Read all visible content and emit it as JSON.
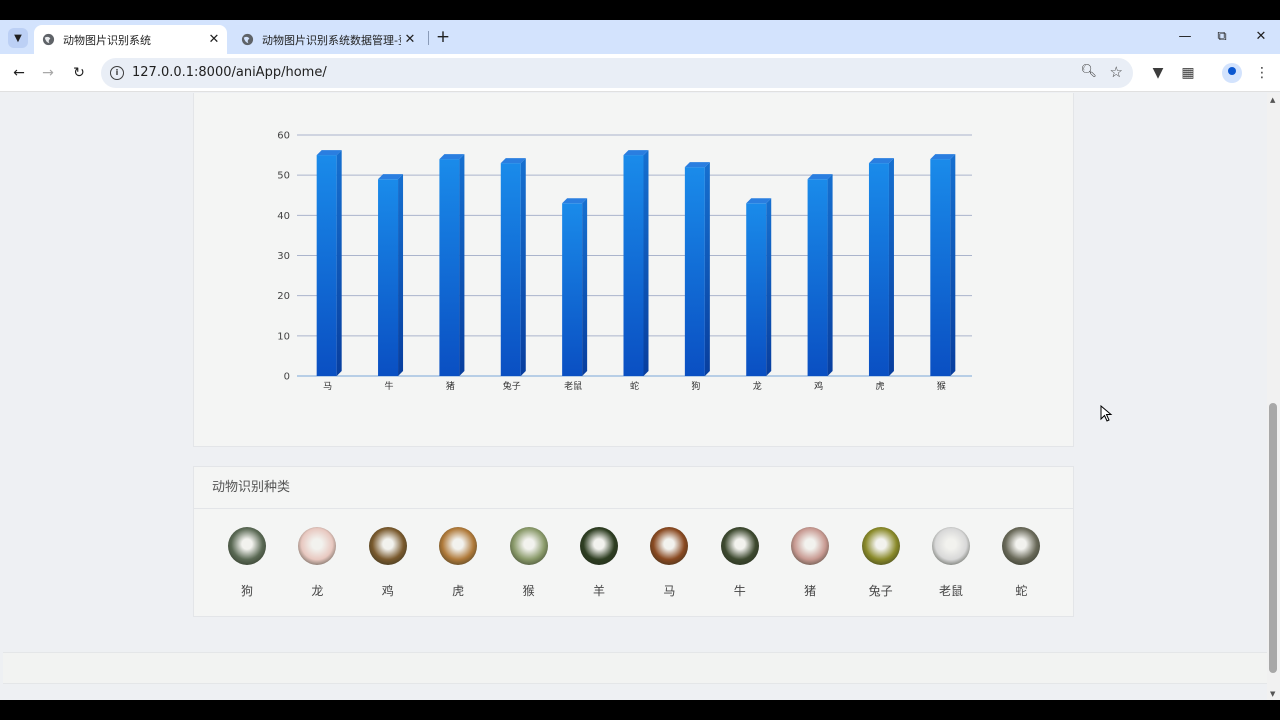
{
  "browser": {
    "tabs": [
      {
        "title": "动物图片识别系统",
        "active": true
      },
      {
        "title": "动物图片识别系统数据管理-登录",
        "active": false
      }
    ],
    "url": "127.0.0.1:8000/aniApp/home/",
    "window_controls": [
      "minimize-icon",
      "restore-icon",
      "close-icon"
    ]
  },
  "chart_data": {
    "type": "bar",
    "categories": [
      "马",
      "牛",
      "猪",
      "兔子",
      "老鼠",
      "蛇",
      "狗",
      "龙",
      "鸡",
      "虎",
      "猴"
    ],
    "values": [
      55,
      49,
      54,
      53,
      43,
      55,
      52,
      43,
      49,
      53,
      54
    ],
    "ylim": [
      0,
      60
    ],
    "yticks": [
      0,
      10,
      20,
      30,
      40,
      50,
      60
    ],
    "grid": true,
    "bar_color_top": "#1a8bea",
    "bar_color_bottom": "#0a4fc2"
  },
  "types_panel": {
    "title": "动物识别种类",
    "animals": [
      {
        "name": "狗",
        "color": "#5b6a55"
      },
      {
        "name": "龙",
        "color": "#e8c8c0"
      },
      {
        "name": "鸡",
        "color": "#7a5a2e"
      },
      {
        "name": "虎",
        "color": "#b07a3a"
      },
      {
        "name": "猴",
        "color": "#8a9a6a"
      },
      {
        "name": "羊",
        "color": "#2e3e22"
      },
      {
        "name": "马",
        "color": "#8a4a22"
      },
      {
        "name": "牛",
        "color": "#3e4a30"
      },
      {
        "name": "猪",
        "color": "#c89a92"
      },
      {
        "name": "兔子",
        "color": "#8a8a2a"
      },
      {
        "name": "老鼠",
        "color": "#d8d8d8"
      },
      {
        "name": "蛇",
        "color": "#6a6a5a"
      }
    ]
  }
}
